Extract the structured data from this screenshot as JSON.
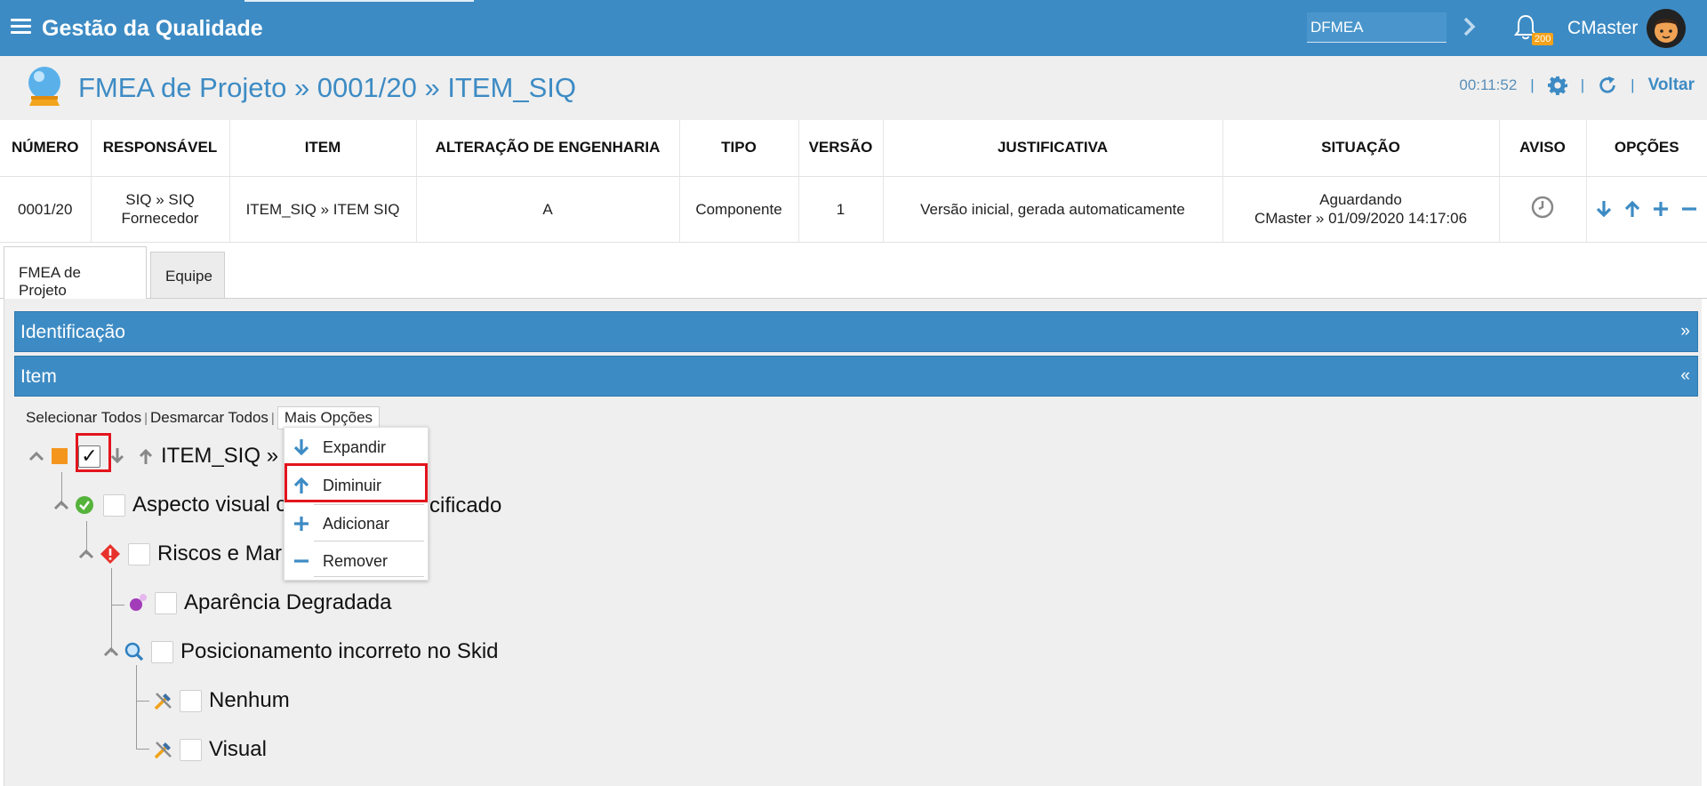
{
  "topbar": {
    "app_title": "Gestão da Qualidade",
    "module_value": "DFMEA",
    "notification_count": "200",
    "user_name": "CMaster"
  },
  "page": {
    "title": "FMEA de Projeto » 0001/20 » ITEM_SIQ",
    "timer": "00:11:52",
    "back_label": "Voltar"
  },
  "info_table": {
    "headers": [
      "NÚMERO",
      "RESPONSÁVEL",
      "ITEM",
      "ALTERAÇÃO DE ENGENHARIA",
      "TIPO",
      "VERSÃO",
      "JUSTIFICATIVA",
      "SITUAÇÃO",
      "AVISO",
      "OPÇÕES"
    ],
    "row": {
      "numero": "0001/20",
      "responsavel_1": "SIQ » SIQ",
      "responsavel_2": "Fornecedor",
      "item": "ITEM_SIQ » ITEM SIQ",
      "alteracao": "A",
      "tipo": "Componente",
      "versao": "1",
      "justificativa": "Versão inicial, gerada automaticamente",
      "situacao_1": "Aguardando",
      "situacao_2": "CMaster » 01/09/2020 14:17:06"
    }
  },
  "tabs": [
    "FMEA de Projeto",
    "Equipe"
  ],
  "sections": {
    "identificacao": "Identificação",
    "identificacao_chevron": "»",
    "item": "Item",
    "item_chevron": "«"
  },
  "toolbar": {
    "select_all": "Selecionar Todos",
    "deselect_all": "Desmarcar Todos",
    "more_options": "Mais Opções"
  },
  "tree": {
    "root": "ITEM_SIQ »",
    "n1": "Aspecto visual c",
    "n1_tail": "cificado",
    "n2": "Riscos e Mar",
    "n3": "Aparência Degradada",
    "n4": "Posicionamento incorreto no Skid",
    "n5": "Nenhum",
    "n6": "Visual"
  },
  "dropdown": {
    "items": [
      "Expandir",
      "Diminuir",
      "Adicionar",
      "Remover"
    ]
  },
  "colors": {
    "brand": "#3d8bc4",
    "highlight": "#e3141c",
    "badge": "#f4a21a"
  }
}
